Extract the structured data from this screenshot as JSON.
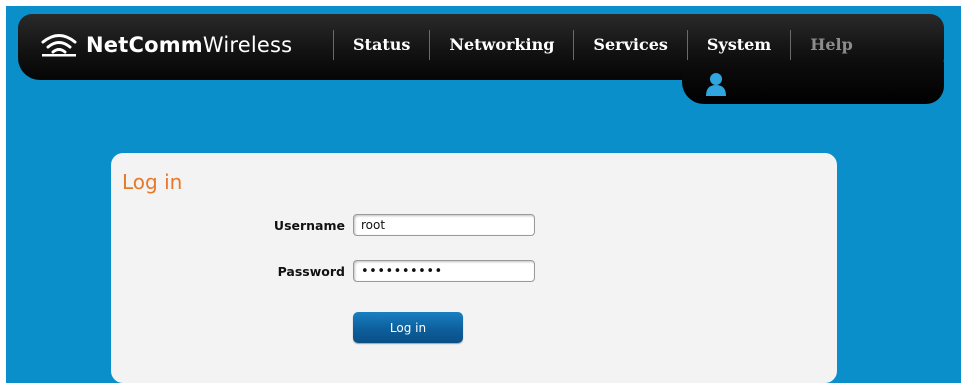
{
  "brand": {
    "name_bold": "NetComm",
    "name_light": "Wireless"
  },
  "nav": {
    "items": [
      {
        "label": "Status"
      },
      {
        "label": "Networking"
      },
      {
        "label": "Services"
      },
      {
        "label": "System"
      },
      {
        "label": "Help"
      }
    ]
  },
  "login": {
    "title": "Log in",
    "username_label": "Username",
    "username_value": "root",
    "password_label": "Password",
    "password_value": "••••••••••",
    "submit_label": "Log in"
  },
  "colors": {
    "background": "#0b8fca",
    "header": "#131313",
    "panel": "#f3f3f3",
    "title_orange": "#e8782a",
    "button_blue": "#0d5f9c"
  },
  "icons": {
    "logo": "wifi-signal-icon",
    "user": "user-icon"
  }
}
